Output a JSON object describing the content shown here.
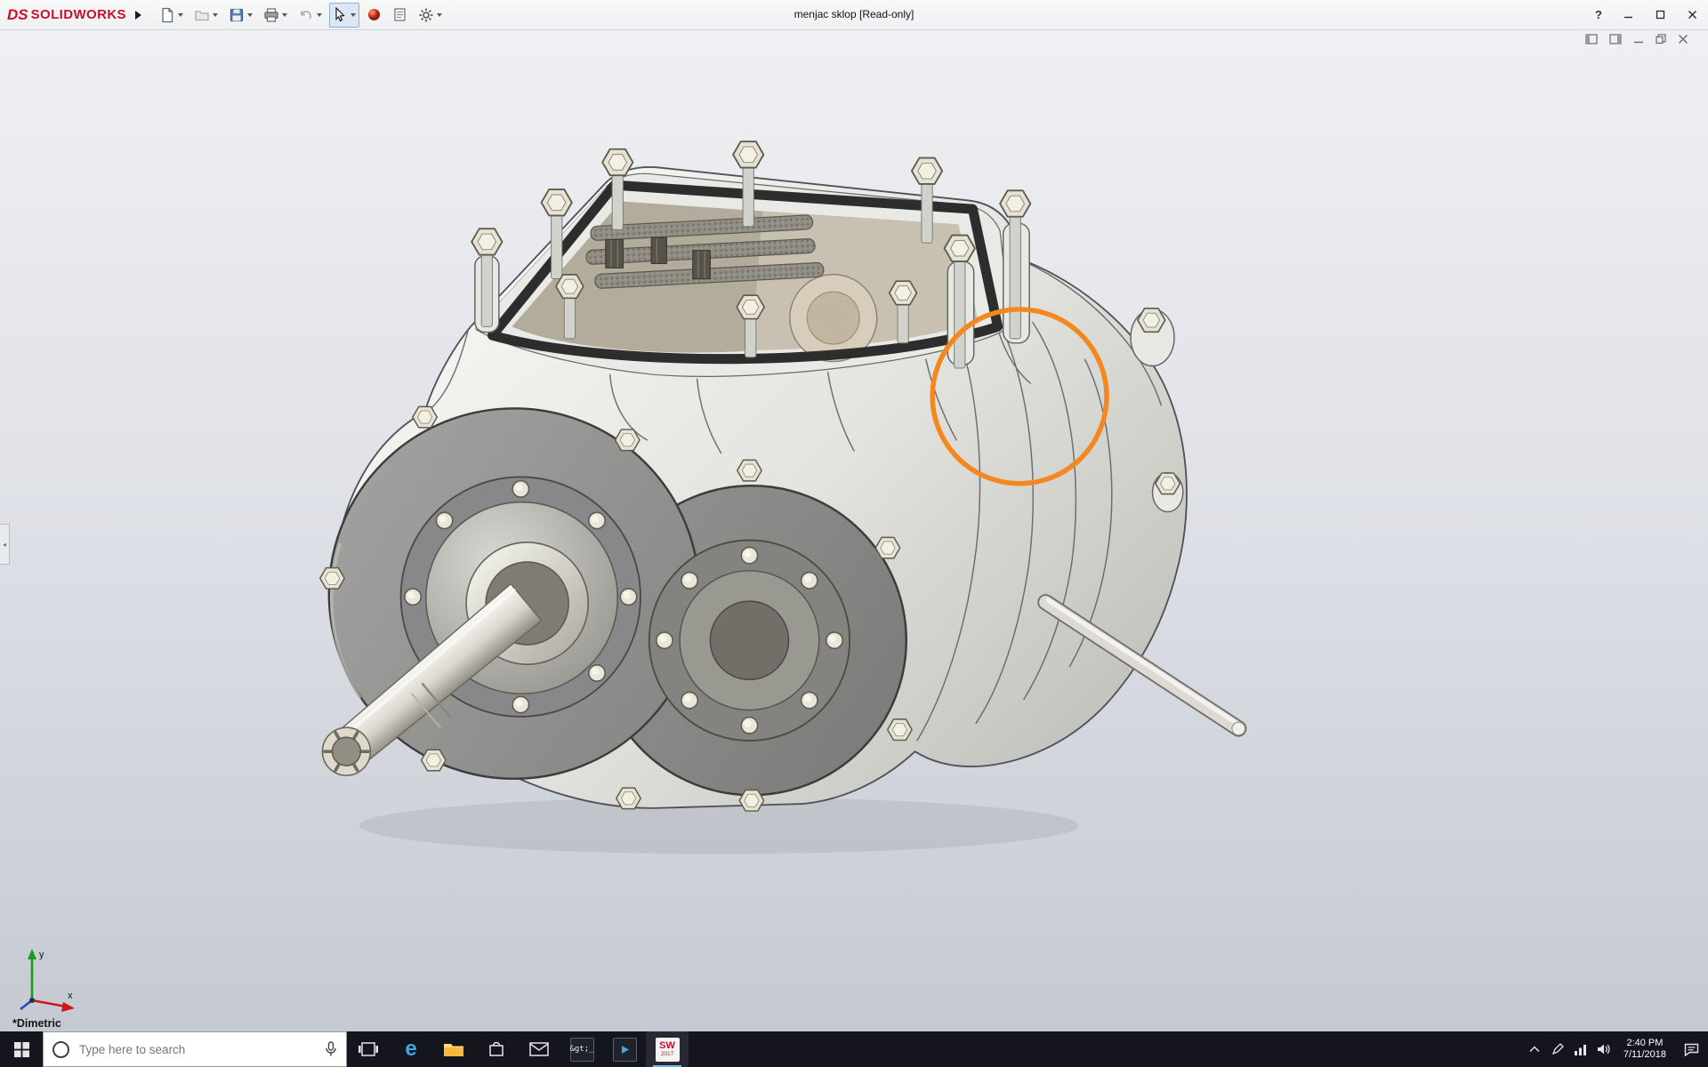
{
  "titlebar": {
    "brand_mark": "DS",
    "brand": "SOLIDWORKS",
    "title": "menjac sklop [Read-only]",
    "help_label": "?"
  },
  "toolbar": {
    "icons": [
      "new-document",
      "open",
      "save",
      "print",
      "undo",
      "select",
      "appearance-sphere",
      "file-properties",
      "options-gear"
    ]
  },
  "viewport": {
    "view_orientation": "*Dimetric",
    "triad_labels": {
      "x": "x",
      "y": "y"
    },
    "annotation_color": "#F5871F",
    "doc_controls": [
      "pane-left",
      "pane-right",
      "minimize",
      "restore",
      "close"
    ]
  },
  "taskbar": {
    "search_placeholder": "Type here to search",
    "icons": [
      "start",
      "search",
      "task-view",
      "edge",
      "file-explorer",
      "store",
      "mail",
      "terminal",
      "app-window",
      "solidworks-2017"
    ],
    "edge_glyph": "e",
    "terminal_glyph": "&gt;_",
    "solidworks_icon": {
      "line1": "SW",
      "line2": "2017"
    },
    "clock": {
      "time": "2:40 PM",
      "date": "7/11/2018"
    }
  }
}
